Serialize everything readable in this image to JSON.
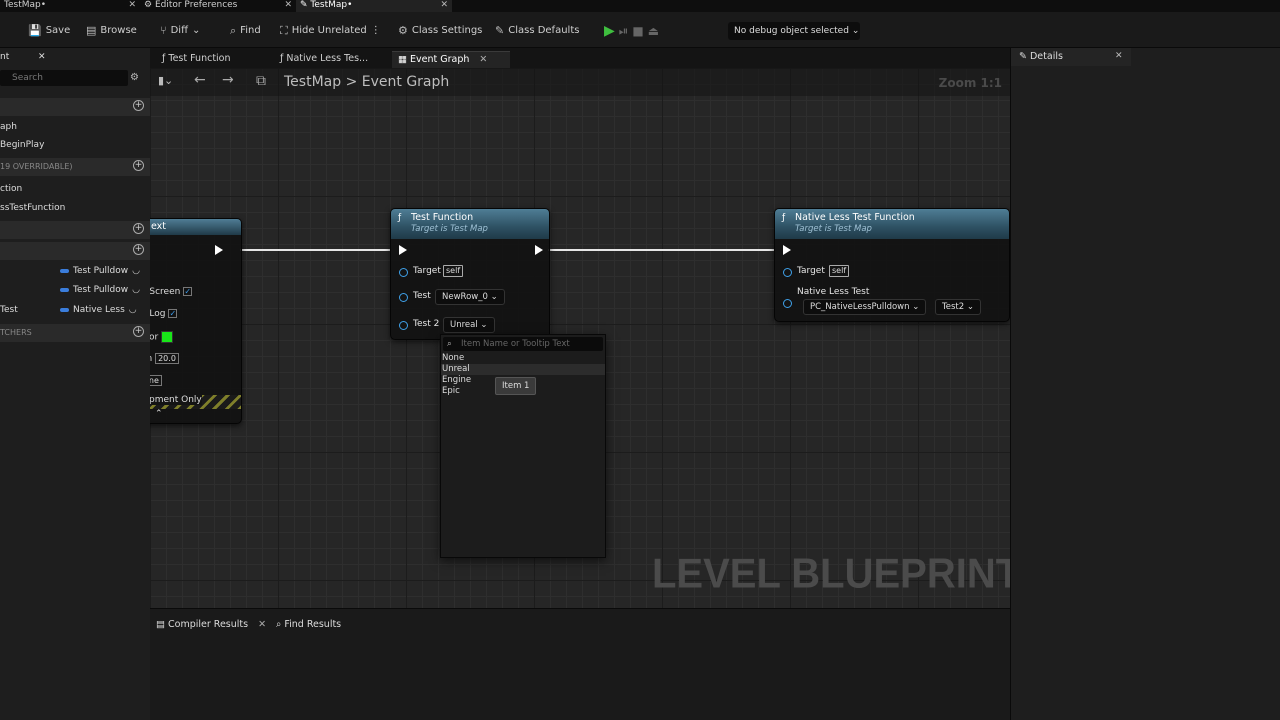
{
  "window_tabs": [
    {
      "label": "TestMap•",
      "active": false
    },
    {
      "label": "Editor Preferences",
      "active": false
    },
    {
      "label": "TestMap•",
      "active": true
    }
  ],
  "toolbar": {
    "save": "Save",
    "browse": "Browse",
    "diff": "Diff",
    "find": "Find",
    "hide_unrelated": "Hide Unrelated",
    "class_settings": "Class Settings",
    "class_defaults": "Class Defaults",
    "debug_object": "No debug object selected"
  },
  "left_panel": {
    "title_fragment": "nt",
    "search_placeholder": "Search",
    "items": {
      "graph": "aph",
      "beginplay": "BeginPlay",
      "overridable": "19 OVERRIDABLE)",
      "function": "ction",
      "nativeless_function": "ssTestFunction",
      "var1": "Test Pulldow",
      "var2": "Test Pulldow",
      "var3_left": "Test",
      "var3": "Native Less",
      "dispatchers": "TCHERS"
    }
  },
  "graph_tabs": [
    {
      "label": "Test Function"
    },
    {
      "label": "Native Less Tes..."
    },
    {
      "label": "Event Graph",
      "active": true
    }
  ],
  "breadcrumb": {
    "root": "TestMap",
    "separator": ">",
    "current": "Event Graph"
  },
  "zoom": "Zoom 1:1",
  "watermark": "LEVEL BLUEPRINT",
  "left_node": {
    "title_fragment": "ext",
    "screen": "o Screen",
    "log": "o Log",
    "color": "olor",
    "duration_label": "on",
    "duration": "20.0",
    "key": "one",
    "dev_only": "lopment Only"
  },
  "test_function_node": {
    "title": "Test Function",
    "subtitle": "Target is Test Map",
    "target_label": "Target",
    "target_value": "self",
    "test_label": "Test",
    "test_value": "NewRow_0",
    "test2_label": "Test 2",
    "test2_value": "Unreal"
  },
  "native_node": {
    "title": "Native Less Test Function",
    "subtitle": "Target is Test Map",
    "target_label": "Target",
    "target_value": "self",
    "param_label": "Native Less Test",
    "param_value": "PC_NativeLessPulldown",
    "param_value2": "Test2"
  },
  "dropdown": {
    "search_placeholder": "Item Name or Tooltip Text",
    "options": [
      "None",
      "Unreal",
      "Engine",
      "Epic"
    ],
    "tooltip": "Item 1"
  },
  "details": {
    "title": "Details"
  },
  "bottom_tabs": {
    "compiler": "Compiler Results",
    "find": "Find Results"
  }
}
